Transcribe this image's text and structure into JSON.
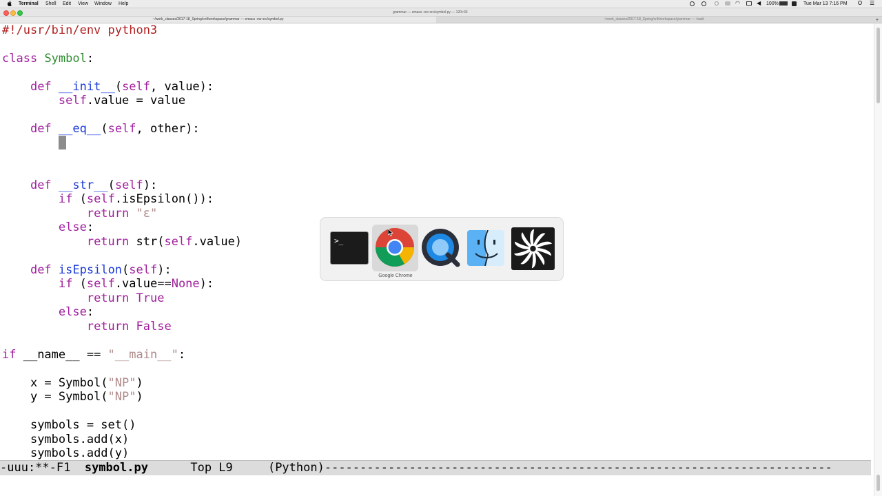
{
  "menubar": {
    "app": "Terminal",
    "items": [
      "Shell",
      "Edit",
      "View",
      "Window",
      "Help"
    ],
    "battery": "100%",
    "clock": "Tue Mar 13  7:16 PM"
  },
  "window": {
    "title": "grammar — emacs -nw src/symbol.py — 120×33",
    "tabs": [
      "~/work_classes/2017-18_Spring/cnf/workspace/grammar — emacs -nw src/symbol.py",
      "~/work_classes/2017-18_Spring/cnf/workspace/grammar — -bash"
    ]
  },
  "code": {
    "l1": "#!/usr/bin/env python3",
    "class_kw": "class",
    "class_name": "Symbol",
    "colon": ":",
    "def": "def",
    "init_name": "__init__",
    "init_args_a": "(",
    "self": "self",
    "init_args_b": ", value):",
    "init_body_b": ".value = value",
    "eq_name": "__eq__",
    "eq_args_b": ", other):",
    "str_name": "__str__",
    "str_args_b": "):",
    "if": "if",
    "if_str_a": " (",
    "if_str_b": ".isEpsilon()):",
    "return": "return",
    "eps": "\"ε\"",
    "else": "else",
    "ret_str_a": " str(",
    "ret_str_b": ".value)",
    "iseps_name": "isEpsilon",
    "iseps_args_b": "):",
    "if_val_b": ".value==",
    "none": "None",
    "close_colon": "):",
    "true": "True",
    "false": "False",
    "main_a": " __name__ == ",
    "main_str": "\"__main__\"",
    "x_a": "x = Symbol(",
    "np": "\"NP\"",
    "paren": ")",
    "y_a": "y = Symbol(",
    "symset": "symbols = set()",
    "addx": "symbols.add(x)",
    "addy": "symbols.add(y)"
  },
  "modeline": {
    "status": "-uuu:**-F1  ",
    "filename": "symbol.py",
    "position": "      Top L9     ",
    "mode": "(Python)",
    "fill": "------------------------------------------------------------------------"
  },
  "switcher": {
    "selected_label": "Google Chrome",
    "apps": [
      "terminal-app-icon",
      "google-chrome-app-icon",
      "quicktime-app-icon",
      "finder-app-icon",
      "fan-app-icon"
    ]
  },
  "colors": {
    "keyword": "#a0209e",
    "class_name": "#2e8b2e",
    "function_name": "#1a3ad9",
    "string": "#b08a8a",
    "shebang": "#b22222"
  }
}
